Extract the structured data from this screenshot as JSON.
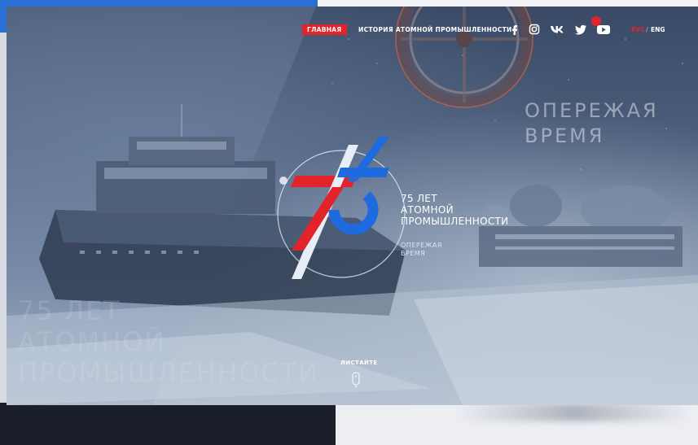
{
  "nav": {
    "home_label": "ГЛАВНАЯ",
    "history_label": "ИСТОРИЯ АТОМНОЙ ПРОМЫШЛЕННОСТИ",
    "social_icons": [
      "facebook-icon",
      "instagram-icon",
      "vk-icon",
      "twitter-icon",
      "youtube-icon"
    ],
    "lang_ru": "РУС",
    "lang_separator": "/",
    "lang_en": "ENG",
    "accent_color": "#e2232a"
  },
  "hero": {
    "slogan_line1": "ОПЕРЕЖАЯ",
    "slogan_line2": "ВРЕМЯ",
    "logo_number": "75",
    "logo_title_line1": "75 ЛЕТ",
    "logo_title_line2": "АТОМНОЙ",
    "logo_title_line3": "ПРОМЫШЛЕННОСТИ",
    "logo_sub_line1": "ОПЕРЕЖАЯ",
    "logo_sub_line2": "ВРЕМЯ",
    "watermark_line1": "75 ЛЕТ",
    "watermark_line2": "АТОМНОЙ",
    "watermark_line3": "ПРОМЫШЛЕННОСТИ",
    "scroll_label": "ЛИСТАЙТЕ"
  },
  "colors": {
    "logo_red": "#e2232a",
    "logo_blue": "#1e6be0"
  }
}
